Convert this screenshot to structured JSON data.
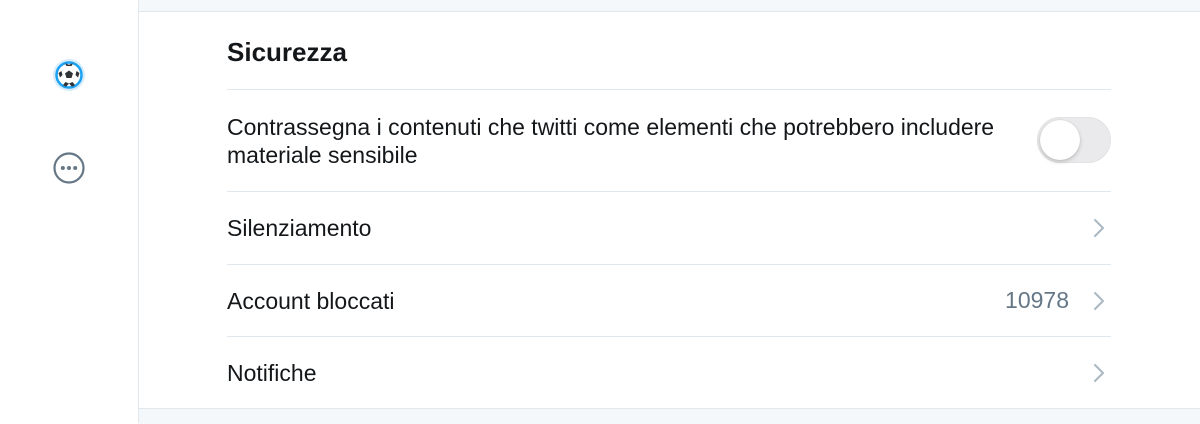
{
  "sidebar": {
    "items": [
      {
        "name": "profile-avatar",
        "icon": "soccer-ball-icon"
      },
      {
        "name": "more",
        "icon": "more-ellipsis-icon"
      }
    ]
  },
  "section": {
    "title": "Sicurezza"
  },
  "rows": [
    {
      "label": "Contrassegna i contenuti che twitti come elementi che potrebbero includere materiale sensibile",
      "control": "toggle",
      "toggle_on": false
    },
    {
      "label": "Silenziamento",
      "control": "chevron"
    },
    {
      "label": "Account bloccati",
      "value": "10978",
      "control": "chevron"
    },
    {
      "label": "Notifiche",
      "control": "chevron"
    }
  ],
  "colors": {
    "text_primary": "#14171a",
    "text_secondary": "#657786",
    "divider": "#e1e8ed",
    "accent": "#1da1f2",
    "toggle_off": "#eaeaec"
  }
}
